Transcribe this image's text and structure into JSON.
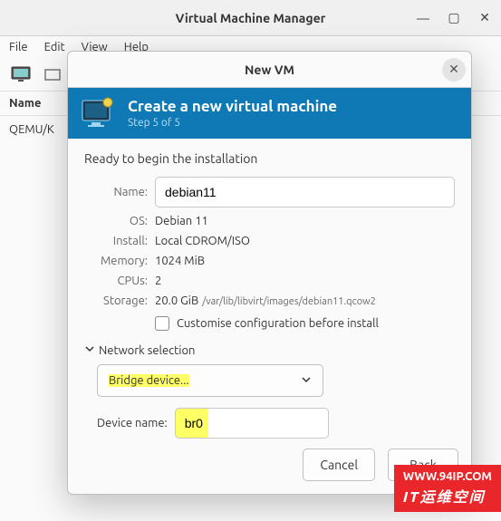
{
  "window": {
    "title": "Virtual Machine Manager",
    "menu": {
      "file": "File",
      "edit": "Edit",
      "view": "View",
      "help": "Help"
    },
    "list_header": "Name",
    "list_item0": "QEMU/K"
  },
  "dialog": {
    "title": "New VM",
    "wizard_title": "Create a new virtual machine",
    "wizard_step": "Step 5 of 5",
    "ready": "Ready to begin the installation",
    "labels": {
      "name": "Name:",
      "os": "OS:",
      "install": "Install:",
      "memory": "Memory:",
      "cpus": "CPUs:",
      "storage": "Storage:"
    },
    "values": {
      "name": "debian11",
      "os": "Debian 11",
      "install": "Local CDROM/ISO",
      "memory": "1024 MiB",
      "cpus": "2",
      "storage_size": "20.0 GiB",
      "storage_path": "/var/lib/libvirt/images/debian11.qcow2"
    },
    "customise_label": "Customise configuration before install",
    "network_section": "Network selection",
    "dropdown_label": "Bridge device...",
    "device_name_label": "Device name:",
    "device_name_value": "br0",
    "buttons": {
      "cancel": "Cancel",
      "back": "Back"
    }
  },
  "watermark": {
    "line1": "WWW.94IP.COM",
    "line2": "IT运维空间"
  }
}
